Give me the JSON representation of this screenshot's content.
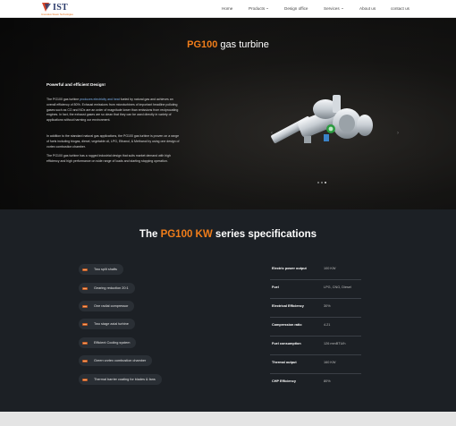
{
  "brand": {
    "name": "IST",
    "tagline": "Innovative Steam Technologies",
    "accent_color": "#f07d1a"
  },
  "nav": {
    "items": [
      {
        "label": "Home",
        "icon": ""
      },
      {
        "label": "Products",
        "icon": "chevron-down-icon"
      },
      {
        "label": "Design office",
        "icon": ""
      },
      {
        "label": "Services",
        "icon": "chevron-down-icon"
      },
      {
        "label": "About us",
        "icon": ""
      },
      {
        "label": "contact us",
        "icon": ""
      }
    ]
  },
  "hero": {
    "title_accent": "PG100",
    "title_rest": " gas turbine",
    "subtitle": "Powerful and efficient Design!",
    "p1_a": "The PG100 gas turbine ",
    "p1_hl": "produces electricity and heat",
    "p1_b": " fueled by natural gas and achieves an overall efficiency of 80%. Exhaust emissions from microturbines of important headline polluting gases such as CO and NOx are an order of magnitude lower than emissions from reciprocating engines. In fact, the exhaust gases are so clean that they can be used directly in variety of applications without harming our environment.",
    "p2": "In addition to the standard natural gas applications, the PG100 gas turbine is proven on a range of fuels including biogas, diesel, vegetable oil, LPG, Ethanol, & Methanol by using one design of vortex combustion chamber.",
    "p3": "The PG100 gas turbine has a rugged industrial design that suits market demand with high efficiency and high performance on wide range of loads and starting stopping operation.",
    "carousel_slides": 3,
    "carousel_active": 3
  },
  "specs": {
    "title_pre": "The ",
    "title_accent": "PG100 KW",
    "title_post": " series specifications",
    "features": [
      "Two split shafts",
      "Gearing reduction 20:1",
      "One radial compressor",
      "Two stage axial turbine",
      "Efficient Cooling system",
      "Green vortex combustion chamber",
      "Thermal barrier coating for blades & fans"
    ],
    "table": [
      {
        "key": "Electric power output",
        "value": "100 KW"
      },
      {
        "key": "Fuel",
        "value": "LPG, CNG, Diesel"
      },
      {
        "key": "Electrical Efficiency",
        "value": "30%"
      },
      {
        "key": "Compression ratio",
        "value": "4.21"
      },
      {
        "key": "Fuel consumption",
        "value": "126 mmBTU/h"
      },
      {
        "key": "Thermal output",
        "value": "160 KW"
      },
      {
        "key": "CHP Efficiency",
        "value": "80%"
      }
    ]
  }
}
